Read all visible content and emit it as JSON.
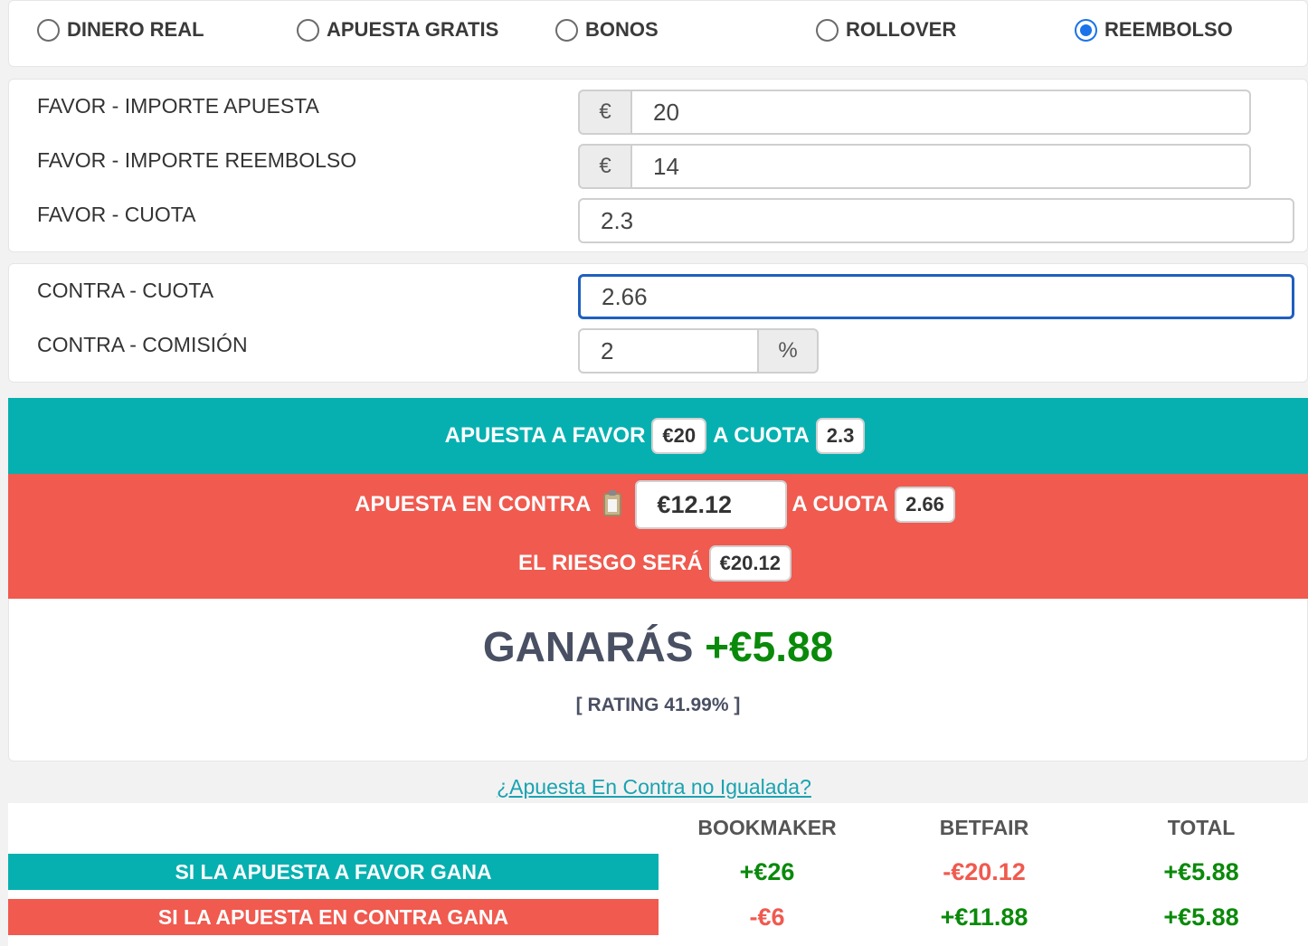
{
  "bet_types": [
    {
      "label": "DINERO REAL",
      "checked": false
    },
    {
      "label": "APUESTA GRATIS",
      "checked": false
    },
    {
      "label": "BONOS",
      "checked": false
    },
    {
      "label": "ROLLOVER",
      "checked": false
    },
    {
      "label": "REEMBOLSO",
      "checked": true
    }
  ],
  "favor": {
    "stake_label": "FAVOR - IMPORTE APUESTA",
    "stake_currency": "€",
    "stake_value": "20",
    "refund_label": "FAVOR - IMPORTE REEMBOLSO",
    "refund_currency": "€",
    "refund_value": "14",
    "odds_label": "FAVOR - CUOTA",
    "odds_value": "2.3"
  },
  "contra": {
    "odds_label": "CONTRA - CUOTA",
    "odds_value": "2.66",
    "commission_label": "CONTRA - COMISIÓN",
    "commission_value": "2",
    "commission_unit": "%"
  },
  "result": {
    "favor_text": "APUESTA A FAVOR",
    "favor_amount": "€20",
    "at_odds_text": "A CUOTA",
    "favor_odds": "2.3",
    "contra_text": "APUESTA EN CONTRA",
    "contra_amount": "€12.12",
    "contra_at_odds_text": "A CUOTA",
    "contra_odds": "2.66",
    "risk_text": "EL RIESGO SERÁ",
    "risk_amount": "€20.12",
    "profit_label": "GANARÁS",
    "profit_value": "+€5.88",
    "rating_text": "[ RATING 41.99% ]"
  },
  "unmatched_link": "¿Apuesta En Contra no Igualada?",
  "table": {
    "headers": [
      "BOOKMAKER",
      "BETFAIR",
      "TOTAL"
    ],
    "rows": [
      {
        "label": "SI LA APUESTA A FAVOR GANA",
        "bookmaker": "+€26",
        "betfair": "-€20.12",
        "total": "+€5.88"
      },
      {
        "label": "SI LA APUESTA EN CONTRA GANA",
        "bookmaker": "-€6",
        "betfair": "+€11.88",
        "total": "+€5.88"
      }
    ]
  },
  "colors": {
    "favor": "#06b0b0",
    "contra": "#f05a4f",
    "positive": "#0a8a0a",
    "negative": "#f05a4f",
    "accent": "#1a73e8"
  }
}
